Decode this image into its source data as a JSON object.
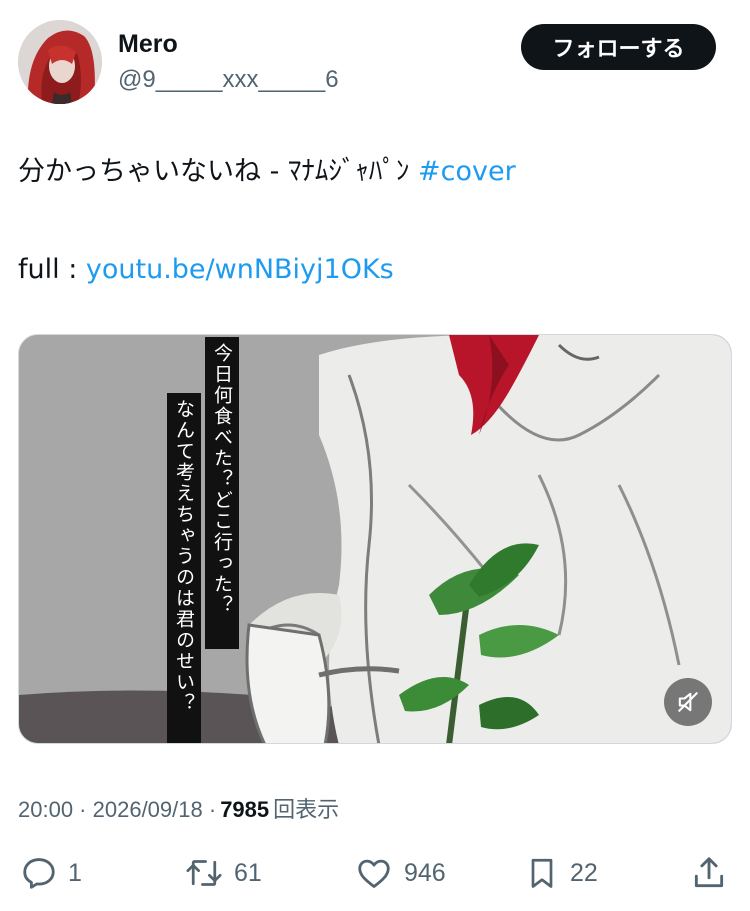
{
  "user": {
    "name": "Mero",
    "handle": "@9_____xxx_____6"
  },
  "follow_button": {
    "label": "フォローする"
  },
  "tweet": {
    "text_prefix": "分かっちゃいないね - ﾏﾅﾑｼﾞｬﾊﾟﾝ ",
    "hashtag": "#cover",
    "link_prefix": "full : ",
    "link": "youtu.be/wnNBiyj1OKs"
  },
  "media": {
    "caption_col1": "今日何食べた？どこ行った？",
    "caption_col2": "なんて考えちゃうのは君のせい？"
  },
  "meta": {
    "time": "20:00",
    "date": "2026/09/18",
    "views": "7985",
    "views_label": "回表示"
  },
  "actions": {
    "replies": "1",
    "retweets": "61",
    "likes": "946",
    "bookmarks": "22"
  },
  "icons": {
    "reply": "reply-icon",
    "retweet": "retweet-icon",
    "like": "heart-icon",
    "bookmark": "bookmark-icon",
    "share": "share-icon",
    "mute": "muted-speaker-icon"
  },
  "colors": {
    "accent": "#1d9bf0",
    "text": "#0f1419",
    "secondary": "#536471"
  }
}
